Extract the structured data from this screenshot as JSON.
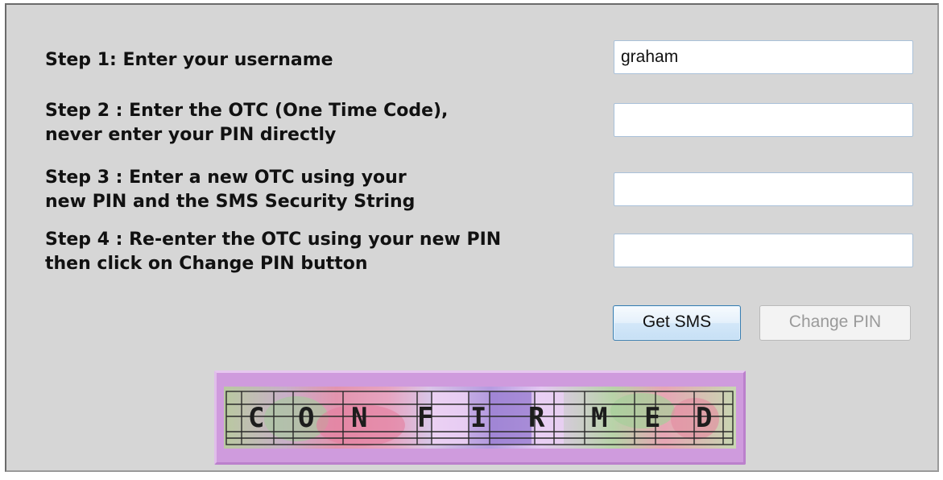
{
  "steps": [
    {
      "label": "Step 1: Enter your username",
      "value": "graham"
    },
    {
      "label": "Step 2 : Enter the OTC (One Time Code),\nnever enter your PIN directly",
      "value": ""
    },
    {
      "label": "Step 3 : Enter a new OTC using your\nnew PIN and the SMS Security String",
      "value": ""
    },
    {
      "label": "Step 4 : Re-enter the OTC using your new PIN\nthen click on Change PIN button",
      "value": ""
    }
  ],
  "buttons": {
    "get_sms": "Get SMS",
    "change_pin": "Change PIN"
  },
  "captcha": {
    "letters": [
      "C",
      "O",
      "N",
      "F",
      "I",
      "R",
      "M",
      "E",
      "D"
    ],
    "colors": {
      "frame": "#cf9bdd",
      "pink": "#e08aa8",
      "green": "#a8c89a",
      "purple": "#a98ad6",
      "lilac": "#e7c4f1"
    }
  },
  "colors": {
    "panel_bg": "#d6d6d6",
    "field_border": "#a9c1d9",
    "primary_button_border": "#3c7fb1",
    "disabled_text": "#9a9a9a"
  }
}
